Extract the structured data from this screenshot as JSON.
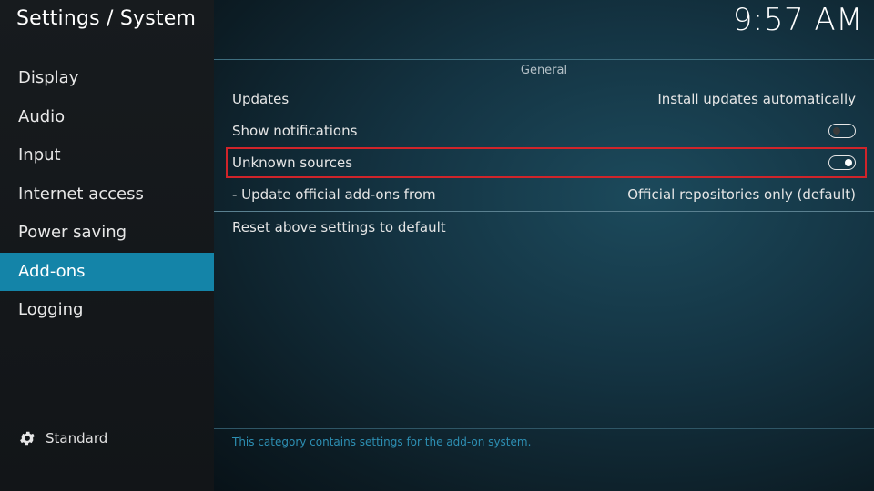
{
  "header": {
    "title": "Settings / System",
    "clock": "9:57 AM"
  },
  "sidebar": {
    "items": [
      {
        "label": "Display"
      },
      {
        "label": "Audio"
      },
      {
        "label": "Input"
      },
      {
        "label": "Internet access"
      },
      {
        "label": "Power saving"
      },
      {
        "label": "Add-ons",
        "active": true
      },
      {
        "label": "Logging"
      }
    ],
    "level": {
      "label": "Standard",
      "icon": "gear-icon"
    }
  },
  "main": {
    "section_heading": "General",
    "settings": [
      {
        "label": "Updates",
        "value": "Install updates automatically"
      },
      {
        "label": "Show notifications",
        "toggle": "off"
      },
      {
        "label": "Unknown sources",
        "toggle": "on",
        "highlighted": true
      },
      {
        "label": "- Update official add-ons from",
        "value": "Official repositories only (default)"
      }
    ],
    "reset_label": "Reset above settings to default",
    "description": "This category contains settings for the add-on system."
  },
  "colors": {
    "accent": "#1484a8",
    "highlight_border": "#d0242a",
    "description_text": "#2d8fb3"
  }
}
